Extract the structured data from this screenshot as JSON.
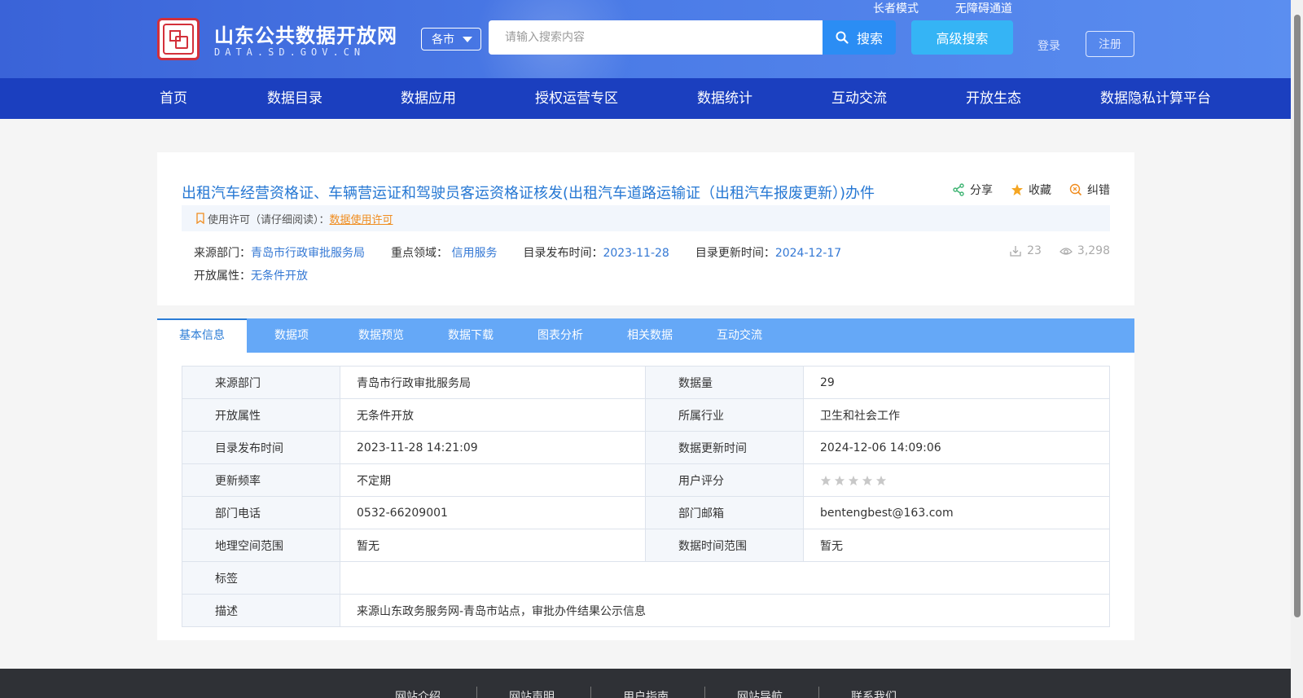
{
  "header": {
    "site_title": "山东公共数据开放网",
    "site_subtitle": "DATA.SD.GOV.CN",
    "elder_mode": "长者模式",
    "accessibility": "无障碍通道",
    "city_select": "各市",
    "search_placeholder": "请输入搜索内容",
    "search_button": "搜索",
    "advanced_search": "高级搜索",
    "login": "登录",
    "register": "注册"
  },
  "nav": [
    "首页",
    "数据目录",
    "数据应用",
    "授权运营专区",
    "数据统计",
    "互动交流",
    "开放生态",
    "数据隐私计算平台"
  ],
  "dataset": {
    "title": "出租汽车经营资格证、车辆营运证和驾驶员客运资格证核发(出租汽车道路运输证（出租汽车报废更新）)办件",
    "actions": {
      "share": "分享",
      "favorite": "收藏",
      "report": "纠错"
    },
    "license_label": "使用许可（请仔细阅读）：",
    "license_link": "数据使用许可",
    "source_label": "来源部门：",
    "source_value": "青岛市行政审批服务局",
    "field_label": "重点领域：",
    "field_value": "信用服务",
    "publish_label": "目录发布时间：",
    "publish_value": "2023-11-28",
    "update_label": "目录更新时间：",
    "update_value": "2024-12-17",
    "open_label": "开放属性：",
    "open_value": "无条件开放",
    "downloads": "23",
    "views": "3,298"
  },
  "tabs": [
    "基本信息",
    "数据项",
    "数据预览",
    "数据下载",
    "图表分析",
    "相关数据",
    "互动交流"
  ],
  "info": {
    "row1": {
      "k1": "来源部门",
      "v1": "青岛市行政审批服务局",
      "k2": "数据量",
      "v2": "29"
    },
    "row2": {
      "k1": "开放属性",
      "v1": "无条件开放",
      "k2": "所属行业",
      "v2": "卫生和社会工作"
    },
    "row3": {
      "k1": "目录发布时间",
      "v1": "2023-11-28 14:21:09",
      "k2": "数据更新时间",
      "v2": "2024-12-06 14:09:06"
    },
    "row4": {
      "k1": "更新频率",
      "v1": "不定期",
      "k2": "用户评分",
      "rating": 0
    },
    "row5": {
      "k1": "部门电话",
      "v1": "0532-66209001",
      "k2": "部门邮箱",
      "v2": "bentengbest@163.com"
    },
    "row6": {
      "k1": "地理空间范围",
      "v1": "暂无",
      "k2": "数据时间范围",
      "v2": "暂无"
    },
    "row7": {
      "k1": "标签",
      "v1": ""
    },
    "row8": {
      "k1": "描述",
      "v1": "来源山东政务服务网-青岛市站点，审批办件结果公示信息"
    }
  },
  "footer": [
    "网站介绍",
    "网站声明",
    "用户指南",
    "网站导航",
    "联系我们"
  ],
  "colors": {
    "nav_bg": "#1b3fbf",
    "tab_bar": "#65a8f7",
    "link_blue": "#3478d4",
    "license_orange": "#f08c1e"
  }
}
